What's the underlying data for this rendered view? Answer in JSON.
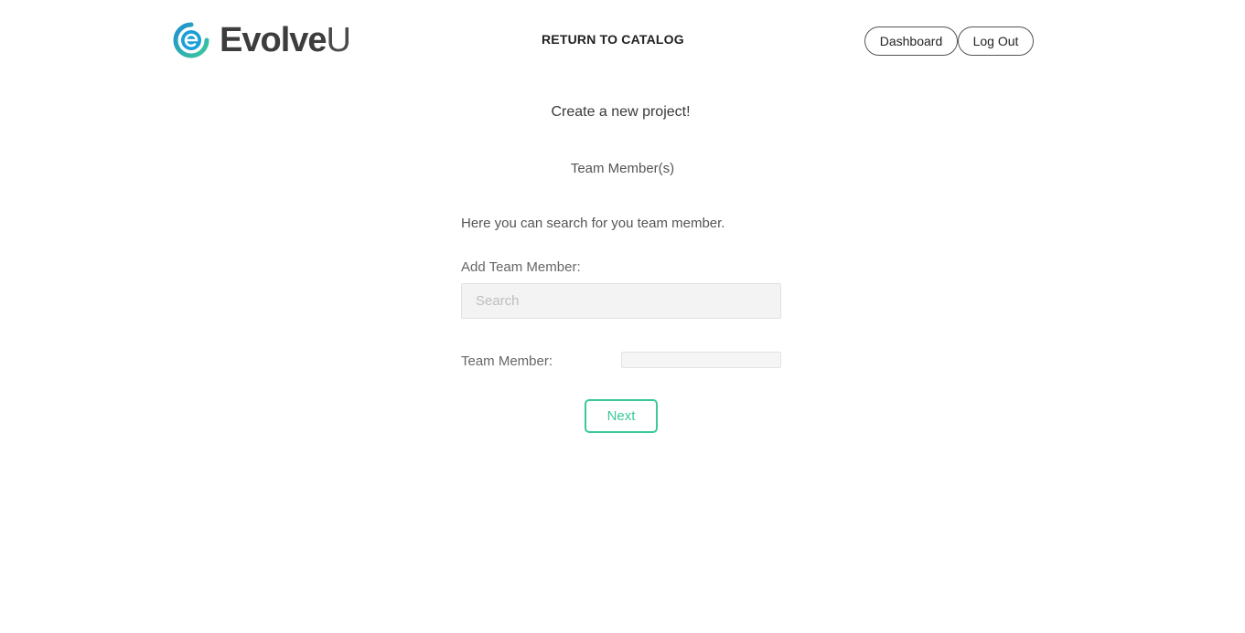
{
  "header": {
    "logo_text_main": "Evolve",
    "logo_text_accent": "U",
    "logo_icon": "evolveu-logo-icon",
    "return_link": "RETURN TO CATALOG",
    "dashboard_button": "Dashboard",
    "logout_button": "Log Out"
  },
  "main": {
    "title": "Create a new project!",
    "subtitle": "Team Member(s)",
    "description": "Here you can search for you team member.",
    "add_label": "Add Team Member:",
    "search_placeholder": "Search",
    "search_value": "",
    "member_label": "Team Member:",
    "member_value": "",
    "next_button": "Next"
  },
  "colors": {
    "accent_green": "#3cc99a",
    "logo_blue": "#1a9fd6",
    "logo_green": "#3cc99a",
    "text_dark": "#333333"
  }
}
